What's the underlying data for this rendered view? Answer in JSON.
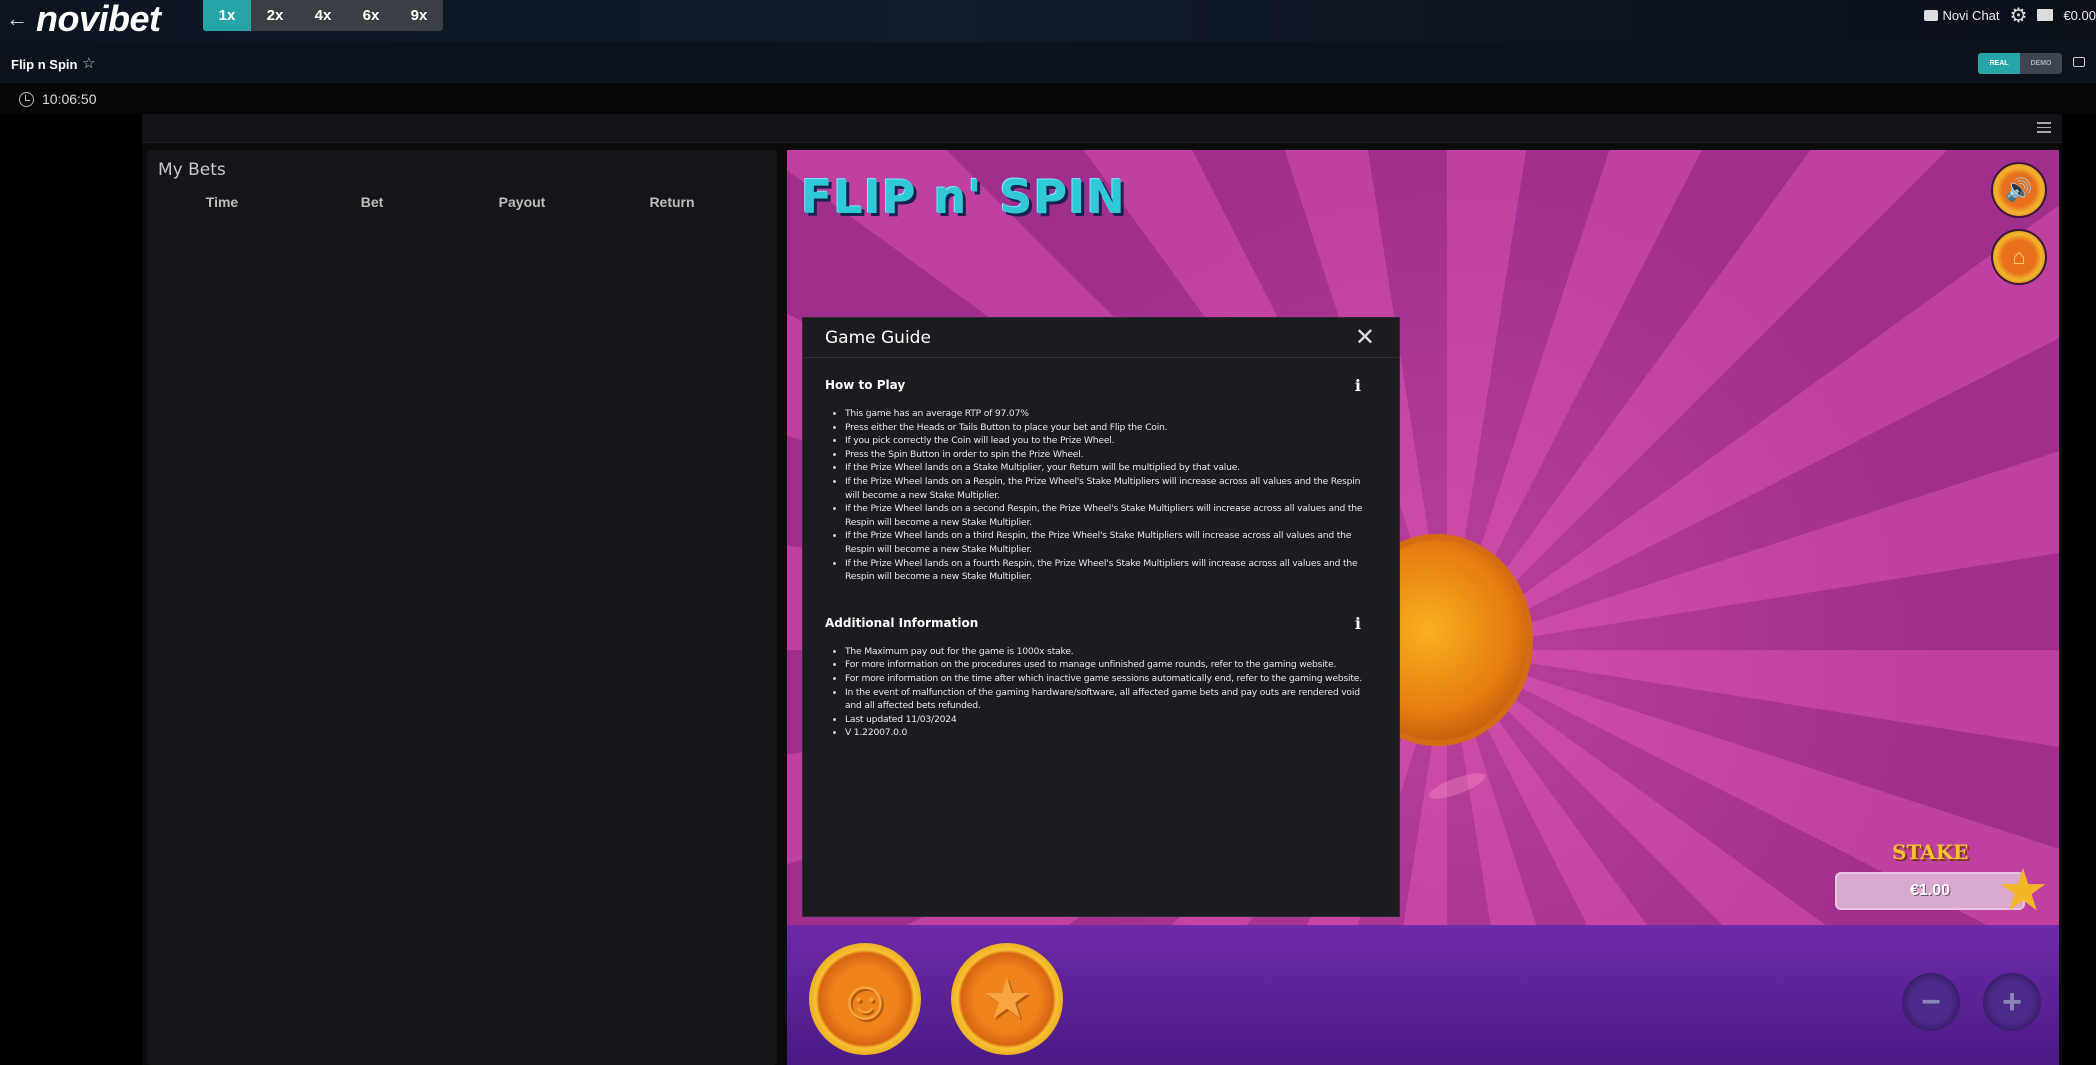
{
  "topbar": {
    "back_glyph": "←",
    "logo": "novibet",
    "speeds": [
      "1x",
      "2x",
      "4x",
      "6x",
      "9x"
    ],
    "chat_label": "Novi Chat",
    "balance": "€0.00"
  },
  "subbar": {
    "game_title": "Flip n Spin",
    "mode_real": "REAL",
    "mode_demo": "DEMO",
    "time": "10:06:50"
  },
  "my_bets": {
    "title": "My Bets",
    "columns": [
      "Time",
      "Bet",
      "Payout",
      "Return"
    ]
  },
  "game": {
    "logo": "FLIP n' SPIN",
    "stake_label": "STAKE",
    "stake_value": "€1.00",
    "minus": "−",
    "plus": "+"
  },
  "modal": {
    "title": "Game Guide",
    "close": "✕",
    "sections": [
      {
        "title": "How to Play",
        "items": [
          "This game has an average RTP of 97.07%",
          "Press either the Heads or Tails Button to place your bet and Flip the Coin.",
          "If you pick correctly the Coin will lead you to the Prize Wheel.",
          "Press the Spin Button in order to spin the Prize Wheel.",
          "If the Prize Wheel lands on a Stake Multiplier, your Return will be multiplied by that value.",
          "If the Prize Wheel lands on a Respin, the Prize Wheel's Stake Multipliers will increase across all values and the Respin will become a new Stake Multiplier.",
          "If the Prize Wheel lands on a second Respin, the Prize Wheel's Stake Multipliers will increase across all values and the Respin will become a new Stake Multiplier.",
          "If the Prize Wheel lands on a third Respin, the Prize Wheel's Stake Multipliers will increase across all values and the Respin will become a new Stake Multiplier.",
          "If the Prize Wheel lands on a fourth Respin, the Prize Wheel's Stake Multipliers will increase across all values and the Respin will become a new Stake Multiplier."
        ]
      },
      {
        "title": "Additional Information",
        "items": [
          "The Maximum pay out for the game is 1000x stake.",
          "For more information on the procedures used to manage unfinished game rounds, refer to the gaming website.",
          "For more information on the time after which inactive game sessions automatically end, refer to the gaming website.",
          "In the event of malfunction of the gaming hardware/software, all affected game bets and pay outs are rendered void and all affected bets refunded.",
          "Last updated 11/03/2024",
          "V 1.22007.0.0"
        ]
      }
    ]
  },
  "colors": {
    "accent": "#27a5a6",
    "game_pink": "#c0409f",
    "game_purple": "#5a1e96",
    "coin_orange": "#e67e10",
    "modal_bg": "#1b1c1f"
  }
}
